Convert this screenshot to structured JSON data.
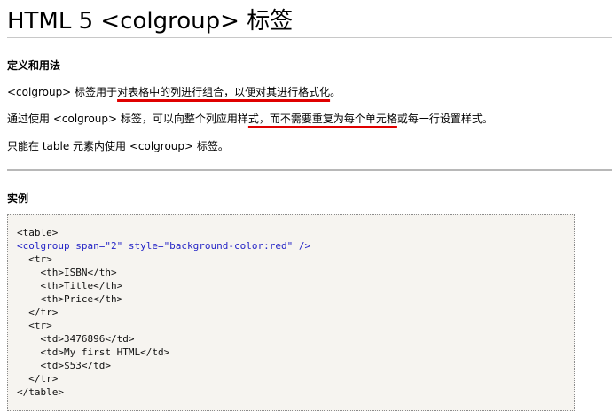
{
  "page": {
    "title": "HTML 5 <colgroup> 标签"
  },
  "definition": {
    "heading": "定义和用法",
    "p1": {
      "tag": "<colgroup>",
      "pre": " 标签用于",
      "underlined": "对表格中的列进行组合，以便对其进行格式化",
      "post": "。"
    },
    "p2": {
      "pre": "通过使用 ",
      "tag": "<colgroup>",
      "mid": " 标签，可以向整个列应用样",
      "underlined": "式，而不需要重复为每个单元格",
      "post": "或每一行设置样式。"
    },
    "p3": {
      "pre": "只能在 table 元素内使用 ",
      "tag": "<colgroup>",
      "post": " 标签。"
    }
  },
  "example": {
    "heading": "实例",
    "code_lines": [
      "<table>",
      "<colgroup span=\"2\" style=\"background-color:red\" />",
      "  <tr>",
      "    <th>ISBN</th>",
      "    <th>Title</th>",
      "    <th>Price</th>",
      "  </tr>",
      "  <tr>",
      "    <td>3476896</td>",
      "    <td>My first HTML</td>",
      "    <td>$53</td>",
      "  </tr>",
      "</table>"
    ]
  },
  "colors": {
    "underline": "#e00000",
    "code_highlight": "#2525c6",
    "code_background": "#f6f4f0"
  }
}
